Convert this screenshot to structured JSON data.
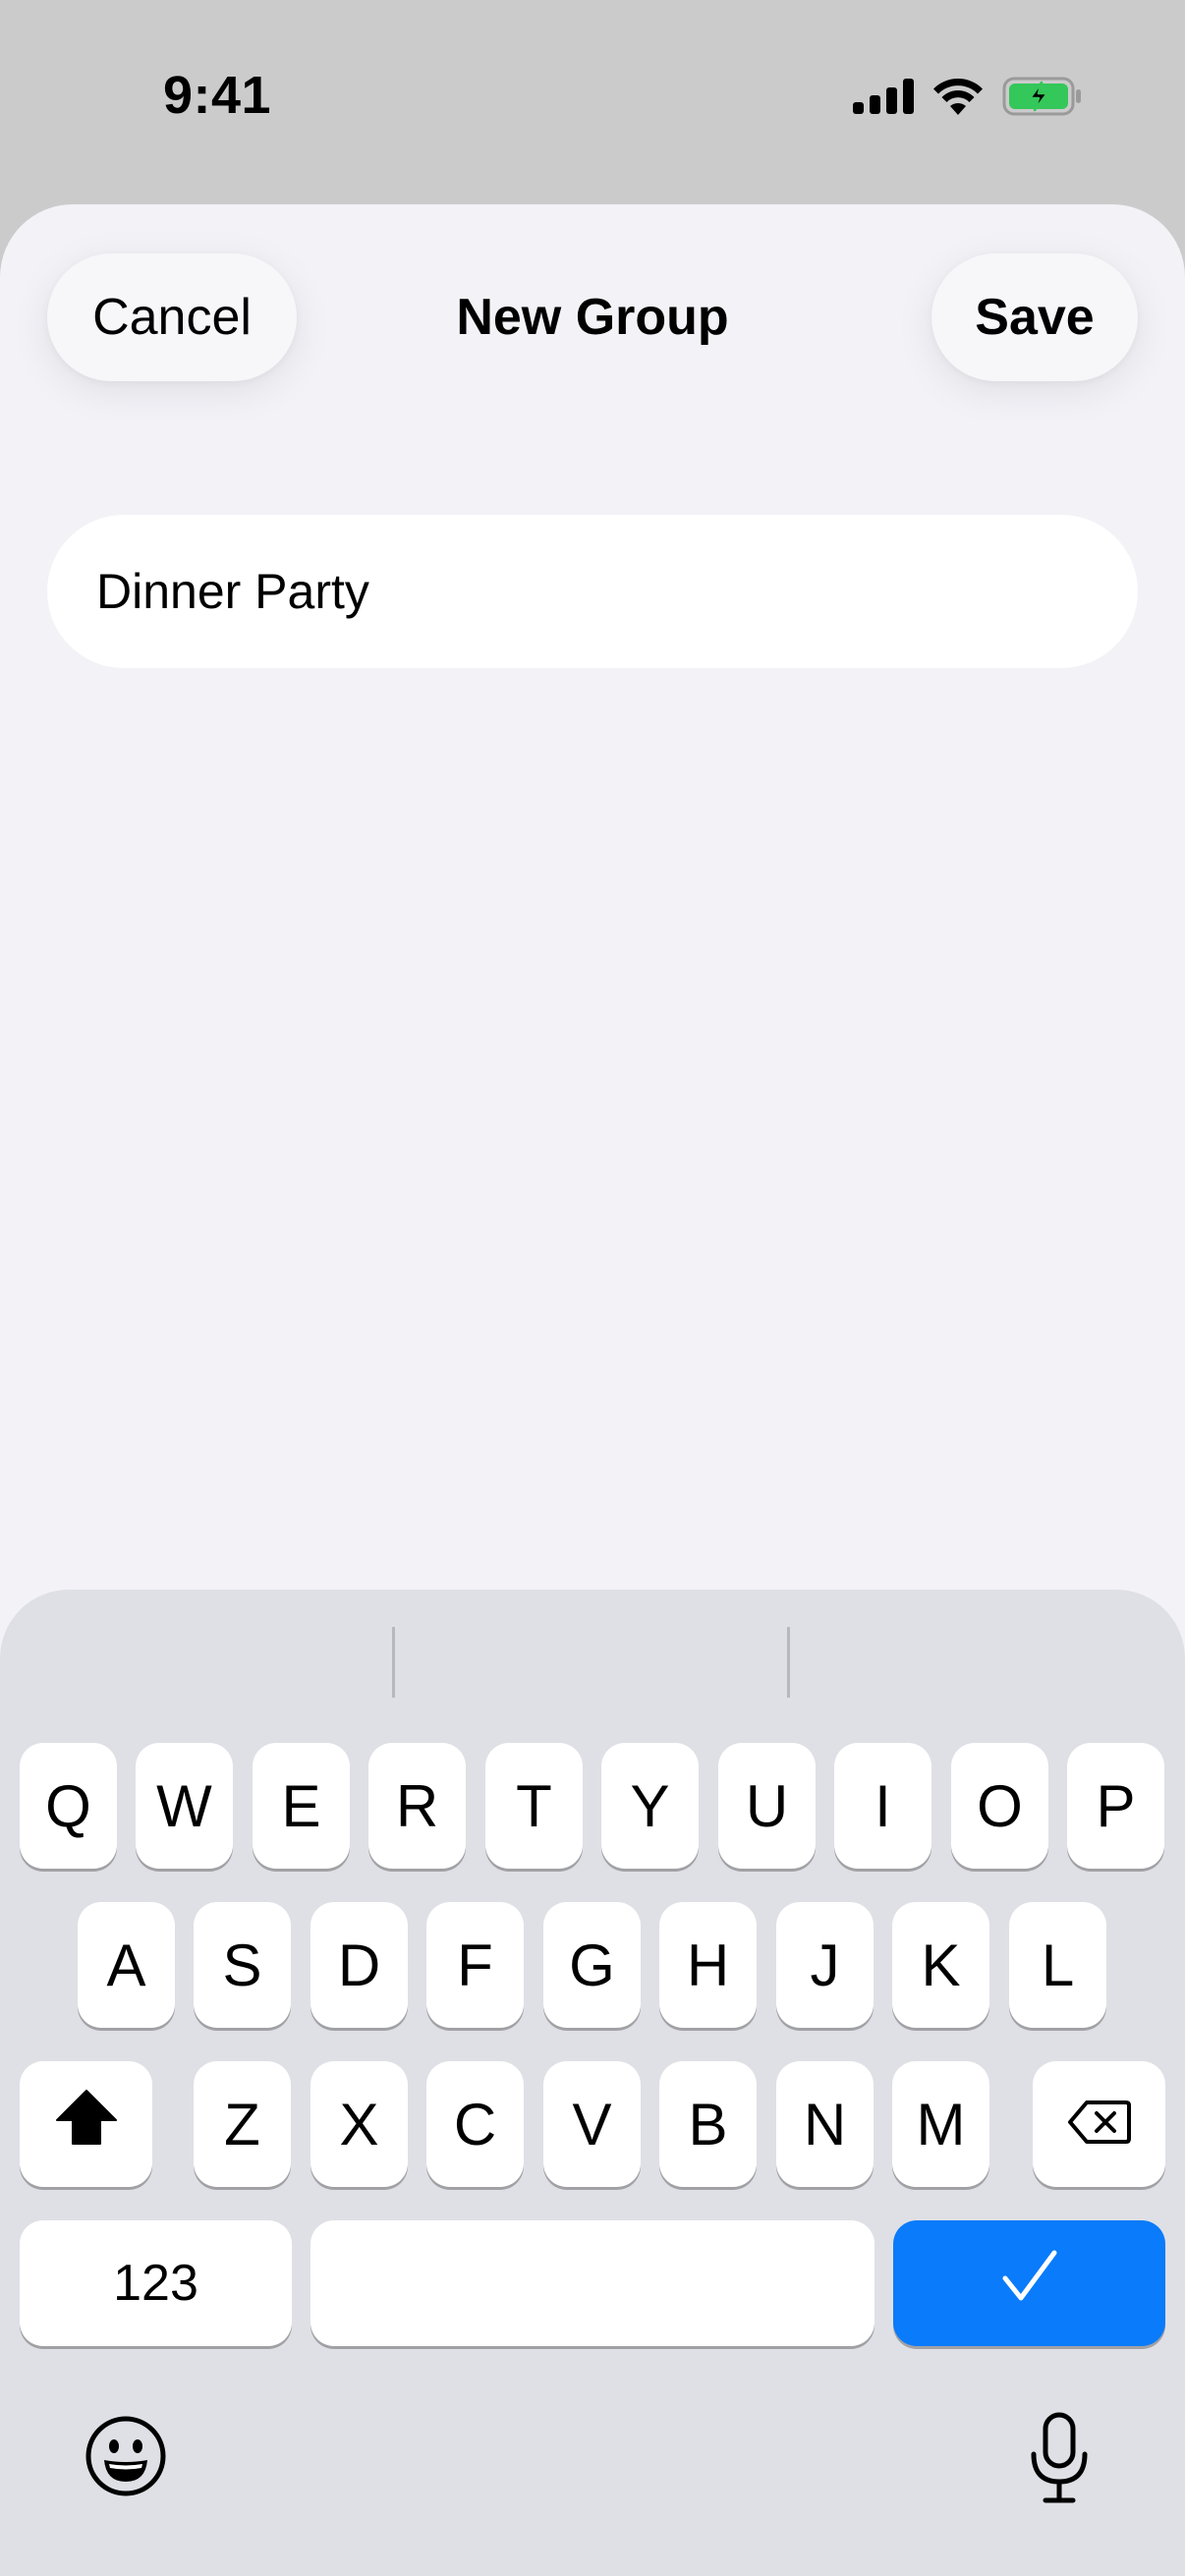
{
  "status_bar": {
    "time": "9:41",
    "icons": [
      "cellular-signal-icon",
      "wifi-icon",
      "battery-charging-icon"
    ],
    "battery_color": "#34c759"
  },
  "sheet": {
    "cancel_label": "Cancel",
    "title": "New Group",
    "save_label": "Save",
    "group_name_value": "Dinner Party"
  },
  "keyboard": {
    "row1": [
      "Q",
      "W",
      "E",
      "R",
      "T",
      "Y",
      "U",
      "I",
      "O",
      "P"
    ],
    "row2": [
      "A",
      "S",
      "D",
      "F",
      "G",
      "H",
      "J",
      "K",
      "L"
    ],
    "row3": [
      "Z",
      "X",
      "C",
      "V",
      "B",
      "N",
      "M"
    ],
    "numbers_label": "123",
    "done_icon": "checkmark-icon",
    "accent_color": "#0a7bfa",
    "bottom_icons": [
      "emoji-icon",
      "microphone-icon"
    ]
  }
}
